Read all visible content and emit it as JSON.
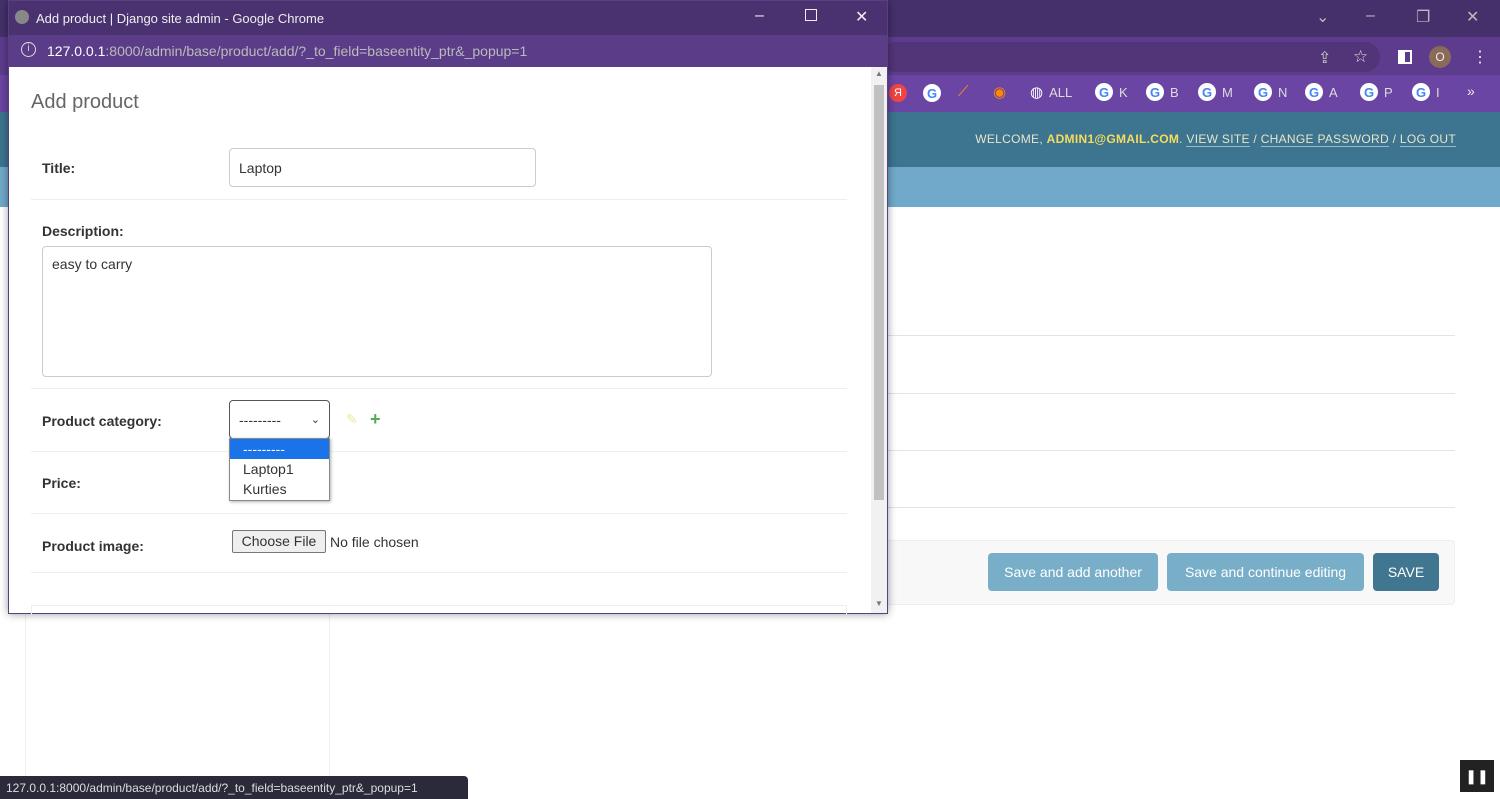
{
  "popup": {
    "window_title": "Add product | Django site admin - Google Chrome",
    "url_host": "127.0.0.1",
    "url_rest": ":8000/admin/base/product/add/?_to_field=baseentity_ptr&_popup=1",
    "heading": "Add product",
    "fields": {
      "title_label": "Title:",
      "title_value": "Laptop",
      "description_label": "Description:",
      "description_value": "easy to carry",
      "category_label": "Product category:",
      "category_selected": "---------",
      "category_options": [
        "---------",
        "Laptop1",
        "Kurties"
      ],
      "price_label": "Price:",
      "image_label": "Product image:",
      "choose_file": "Choose File",
      "no_file": "No file chosen"
    }
  },
  "browser": {
    "bookmarks": [
      "ALL",
      "K",
      "B",
      "M",
      "N",
      "A",
      "P",
      "I"
    ],
    "profile_initial": "O"
  },
  "admin": {
    "welcome": "WELCOME, ",
    "user": "ADMIN1@GMAIL.COM",
    "view_site": "VIEW SITE",
    "change_password": "CHANGE PASSWORD",
    "log_out": "LOG OUT",
    "save_add_another": "Save and add another",
    "save_continue": "Save and continue editing",
    "save": "SAVE"
  },
  "status_url": "127.0.0.1:8000/admin/base/product/add/?_to_field=baseentity_ptr&_popup=1",
  "colors": {
    "header": "#3d7490",
    "breadcrumbs": "#70a9c9",
    "button": "#79aec8",
    "save_button": "#417690",
    "chrome": "#5d3c8e"
  }
}
